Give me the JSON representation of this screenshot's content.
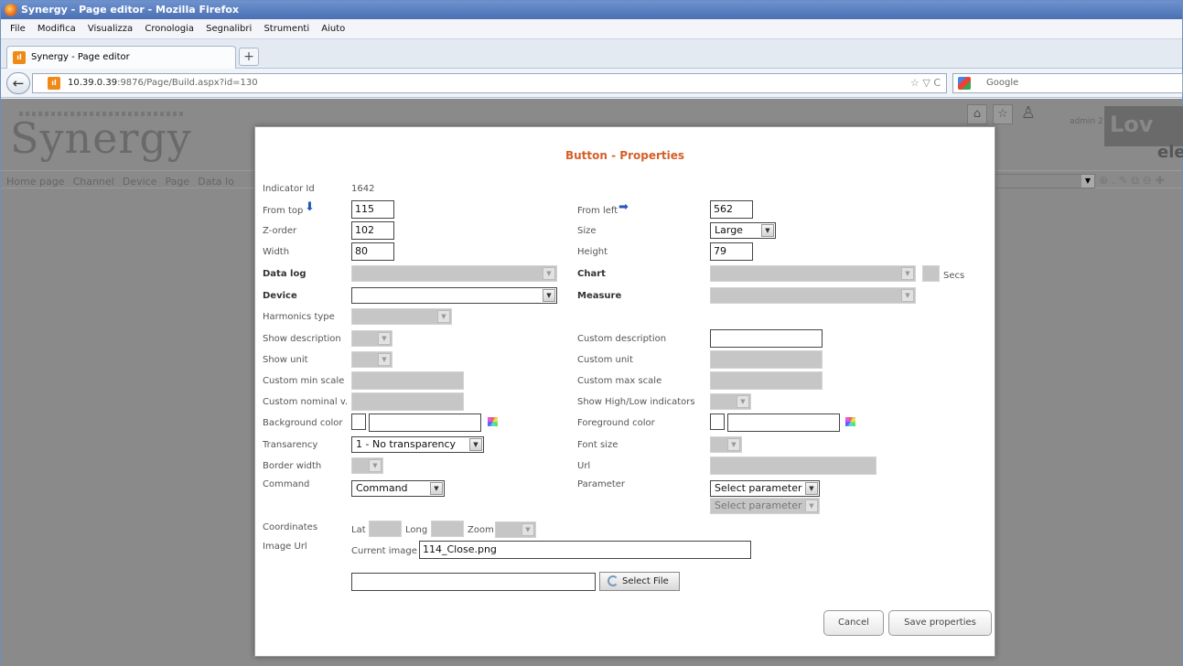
{
  "window": {
    "title": "Synergy - Page editor - Mozilla Firefox"
  },
  "menu": [
    "File",
    "Modifica",
    "Visualizza",
    "Cronologia",
    "Segnalibri",
    "Strumenti",
    "Aiuto"
  ],
  "tab": {
    "label": "Synergy - Page editor",
    "new_tab": "+"
  },
  "nav": {
    "url_host": "10.39.0.39",
    "url_path": ":9876/Page/Build.aspx?id=130",
    "search_placeholder": "Google",
    "back_icon": "←",
    "url_controls": "☆ ▽ C"
  },
  "app": {
    "logo": "Synergy",
    "nav_items": [
      "Home page",
      "Channel",
      "Device",
      "Page",
      "Data lo"
    ],
    "user": "admin 2",
    "brand": "Lov",
    "brand2": "ele"
  },
  "dialog": {
    "title": "Button - Properties",
    "indicator_id": {
      "label": "Indicator Id",
      "value": "1642"
    },
    "from_top": {
      "label": "From top",
      "value": "115"
    },
    "from_left": {
      "label": "From left",
      "value": "562"
    },
    "z_order": {
      "label": "Z-order",
      "value": "102"
    },
    "size": {
      "label": "Size",
      "value": "Large"
    },
    "width": {
      "label": "Width",
      "value": "80"
    },
    "height": {
      "label": "Height",
      "value": "79"
    },
    "data_log": {
      "label": "Data log",
      "value": ""
    },
    "chart": {
      "label": "Chart",
      "value": "",
      "secs_label": "Secs"
    },
    "device": {
      "label": "Device",
      "value": ""
    },
    "measure": {
      "label": "Measure",
      "value": ""
    },
    "harmonics_type": {
      "label": "Harmonics type"
    },
    "show_description": {
      "label": "Show description"
    },
    "custom_description": {
      "label": "Custom description",
      "value": ""
    },
    "show_unit": {
      "label": "Show unit"
    },
    "custom_unit": {
      "label": "Custom unit"
    },
    "custom_min_scale": {
      "label": "Custom min scale"
    },
    "custom_max_scale": {
      "label": "Custom max scale"
    },
    "custom_nominal": {
      "label": "Custom nominal v."
    },
    "show_high_low": {
      "label": "Show High/Low indicators"
    },
    "background_color": {
      "label": "Background color",
      "value": ""
    },
    "foreground_color": {
      "label": "Foreground color",
      "value": ""
    },
    "transparency": {
      "label": "Transarency",
      "value": "1 - No transparency"
    },
    "font_size": {
      "label": "Font size"
    },
    "border_width": {
      "label": "Border width"
    },
    "url": {
      "label": "Url"
    },
    "command": {
      "label": "Command",
      "value": "Command"
    },
    "parameter": {
      "label": "Parameter",
      "value": "Select parameter",
      "value2": "Select parameter"
    },
    "coordinates": {
      "label": "Coordinates",
      "lat": "Lat",
      "long": "Long",
      "zoom": "Zoom"
    },
    "image_url": {
      "label": "Image Url",
      "current_label": "Current image",
      "current_value": "114_Close.png",
      "select_file": "Select File"
    },
    "cancel": "Cancel",
    "save": "Save properties"
  },
  "colors": {
    "title_accent": "#d4602a",
    "arrow_blue": "#2458b8"
  }
}
